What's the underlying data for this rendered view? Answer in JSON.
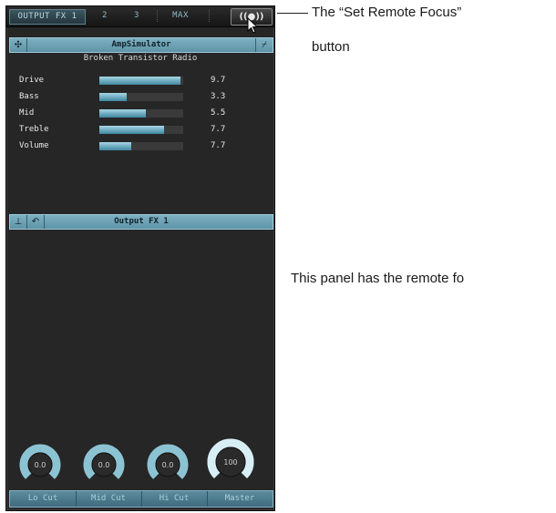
{
  "tabs": [
    {
      "label": "OUTPUT FX 1",
      "active": true
    },
    {
      "label": "2",
      "active": false
    },
    {
      "label": "3",
      "active": false
    },
    {
      "label": "MAX",
      "active": false
    }
  ],
  "remote_button": {
    "label": "((●))",
    "icon": "remote-focus-icon"
  },
  "insert": {
    "title": "AmpSimulator",
    "preset": "Broken Transistor Radio",
    "params": [
      {
        "name": "Drive",
        "value": "9.7",
        "level": 0.97
      },
      {
        "name": "Bass",
        "value": "3.3",
        "level": 0.33
      },
      {
        "name": "Mid",
        "value": "5.5",
        "level": 0.55
      },
      {
        "name": "Treble",
        "value": "7.7",
        "level": 0.77
      },
      {
        "name": "Volume",
        "value": "7.7",
        "level": 0.38
      }
    ]
  },
  "output_section": {
    "title": "Output  FX 1"
  },
  "knobs": [
    {
      "label": "Lo Cut",
      "value": "0.0",
      "level": 0.0
    },
    {
      "label": "Mid Cut",
      "value": "0.0",
      "level": 0.0
    },
    {
      "label": "Hi Cut",
      "value": "0.0",
      "level": 0.0
    },
    {
      "label": "Master",
      "value": "100",
      "level": 1.0
    }
  ],
  "annotations": {
    "remote_line1": "The “Set Remote Focus”",
    "remote_line2": "button",
    "panel_note": "This panel has the remote fo"
  },
  "colors": {
    "accent": "#6fa4b8",
    "panel": "#262626",
    "fill": "#5aa6bf"
  }
}
